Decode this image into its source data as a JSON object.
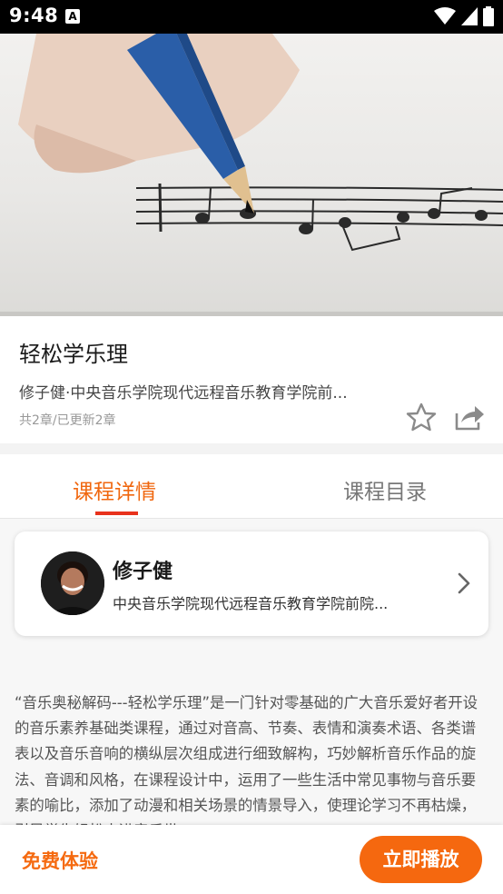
{
  "status_bar": {
    "time": "9:48",
    "notification_badge": "A",
    "icons": [
      "wifi-icon",
      "signal-icon",
      "battery-icon"
    ]
  },
  "course": {
    "title": "轻松学乐理",
    "author_line": "修子健·中央音乐学院现代远程音乐教育学院前...",
    "chapters_info": "共2章/已更新2章",
    "actions": [
      "star-icon",
      "share-icon"
    ]
  },
  "tabs": {
    "detail": "课程详情",
    "catalog": "课程目录",
    "active": "detail"
  },
  "teacher": {
    "name": "修子健",
    "description": "中央音乐学院现代远程音乐教育学院前院..."
  },
  "description": "“音乐奥秘解码---轻松学乐理”是一门针对零基础的广大音乐爱好者开设的音乐素养基础类课程，通过对音高、节奏、表情和演奏术语、各类谱表以及音乐音响的横纵层次组成进行细致解构，巧妙解析音乐作品的旋法、音调和风格，在课程设计中，运用了一些生活中常见事物与音乐要素的喻比，添加了动漫和相关场景的情景导入，使理论学习不再枯燥，引导学生轻松走进音乐世",
  "bottom_bar": {
    "trial_label": "免费体验",
    "play_label": "立即播放"
  },
  "colors": {
    "accent": "#f5680f",
    "tab_active": "#f0670f",
    "tab_indicator": "#e8321c"
  }
}
